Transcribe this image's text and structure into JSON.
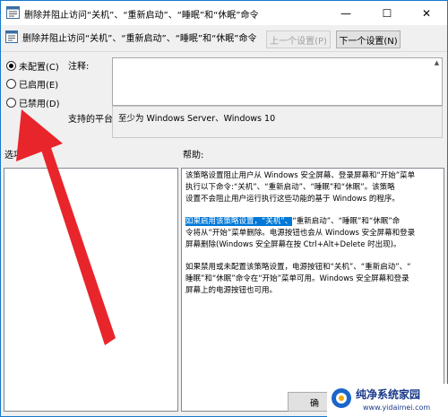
{
  "window": {
    "title": "删除并阻止访问“关机”、“重新启动”、“睡眠”和“休眠”命令",
    "controls": {
      "minimize": "—",
      "maximize": "☐",
      "close": "✕"
    }
  },
  "header": {
    "policy_title": "删除并阻止访问“关机”、“重新启动”、“睡眠”和“休眠”命令",
    "prev_button": "上一个设置(P)",
    "next_button": "下一个设置(N)"
  },
  "radios": {
    "not_configured": "未配置(C)",
    "enabled": "已启用(E)",
    "disabled": "已禁用(D)",
    "selected": "not_configured"
  },
  "labels": {
    "comment": "注释:",
    "supported_on": "支持的平台:",
    "options": "选项:",
    "help": "帮助:"
  },
  "supported_platform": "至少为 Windows Server、Windows 10",
  "help_text": {
    "p1_l1": "该策略设置阻止用户从 Windows 安全屏幕、登录屏幕和“开始”菜单",
    "p1_l2": "执行以下命令:“关机”、“重新启动”、“睡眠”和“休眠”。该策略",
    "p1_l3": "设置不会阻止用户运行执行这些功能的基于 Windows 的程序。",
    "p2_l1_hl": "如果启用该策略设置，“关机”、",
    "p2_l1_rest": "“重新启动”、“睡眠”和“休眠”命",
    "p2_l2": "令将从“开始”菜单删除。电源按钮也会从 Windows 安全屏幕和登录",
    "p2_l3": "屏幕删除(Windows 安全屏幕在按 Ctrl+Alt+Delete 时出现)。",
    "p3_l1": "如果禁用或未配置该策略设置，电源按钮和“关机”、“重新启动”、“",
    "p3_l2": "睡眠”和“休眠”命令在“开始”菜单可用。Windows 安全屏幕和登录",
    "p3_l3": "屏幕上的电源按钮也可用。"
  },
  "footer": {
    "ok_button": "确"
  },
  "watermark": {
    "name": "纯净系统家园",
    "url": "www.yidaimei.com"
  },
  "colors": {
    "accent": "#0078d7",
    "arrow": "#e8252b"
  }
}
